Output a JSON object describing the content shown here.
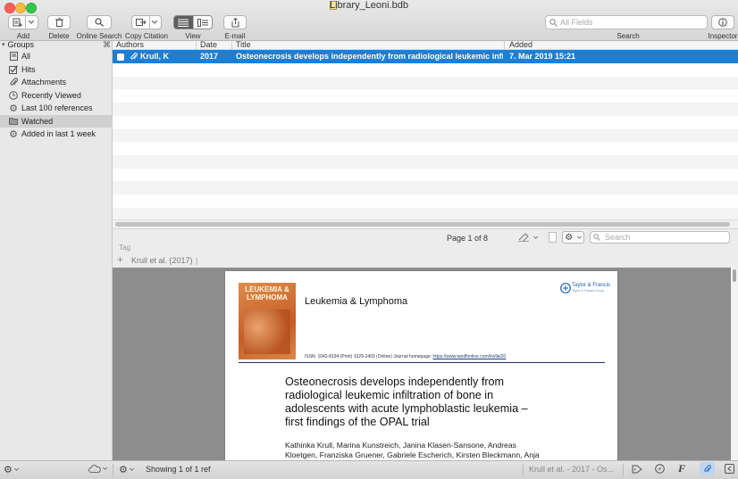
{
  "window": {
    "title": "Library_Leoni.bdb"
  },
  "toolbar": {
    "add_label": "Add",
    "delete_label": "Delete",
    "online_search_label": "Online Search",
    "copy_citation_label": "Copy Citation",
    "view_label": "View",
    "email_label": "E-mail",
    "search_label": "Search",
    "search_placeholder": "All Fields",
    "inspector_label": "Inspector"
  },
  "sidebar": {
    "header": "Groups",
    "items": [
      {
        "label": "All",
        "icon": "library-icon"
      },
      {
        "label": "Hits",
        "icon": "checkbox-icon"
      },
      {
        "label": "Attachments",
        "icon": "paperclip-icon"
      },
      {
        "label": "Recently Viewed",
        "icon": "clock-icon"
      },
      {
        "label": "Last 100 references",
        "icon": "gear-icon"
      },
      {
        "label": "Watched",
        "icon": "folder-icon"
      },
      {
        "label": "Added in last 1 week",
        "icon": "gear-icon"
      }
    ]
  },
  "table": {
    "columns": [
      "Authors",
      "Date",
      "Title",
      "Added"
    ],
    "rows": [
      {
        "authors": "Krull, K",
        "date": "2017",
        "title": "Osteonecrosis develops independently from radiological leukemic infiltration",
        "added": "7. Mar 2019 15:21"
      }
    ]
  },
  "preview": {
    "page_indicator": "Page 1 of 8",
    "search_placeholder": "Search",
    "tag_label": "Tag",
    "reference": "Krull et al. (2017)"
  },
  "pdf": {
    "cover_title_line1": "LEUKEMIA &",
    "cover_title_line2": "LYMPHOMA",
    "journal": "Leukemia & Lymphoma",
    "publisher": "Taylor & Francis",
    "publisher_tagline": "Taylor & Francis Group",
    "issn_line": "ISSN: 1042-8194 (Print) 1029-2403 (Online) Journal homepage: ",
    "issn_link": "https://www.tandfonline.com/loi/ilal20",
    "title_lines": [
      "Osteonecrosis develops independently from",
      "radiological leukemic infiltration of bone in",
      "adolescents with acute lymphoblastic leukemia –",
      "first findings of the OPAL trial"
    ],
    "authors_lines": [
      "Kathinka Krull, Marina Kunstreich, Janina Klasen-Sansone, Andreas",
      "Kloetgen, Franziska Gruener, Gabriele Escherich, Kirsten Bleckmann, Anja"
    ]
  },
  "statusbar": {
    "showing": "Showing 1 of 1 ref",
    "breadcrumb": "Krull et al. - 2017 - Os..."
  },
  "colors": {
    "selection": "#1b7fd6",
    "close": "#fc605c",
    "minimize": "#fdbc40",
    "zoom": "#34c84a",
    "cover": "#d77a3b"
  }
}
